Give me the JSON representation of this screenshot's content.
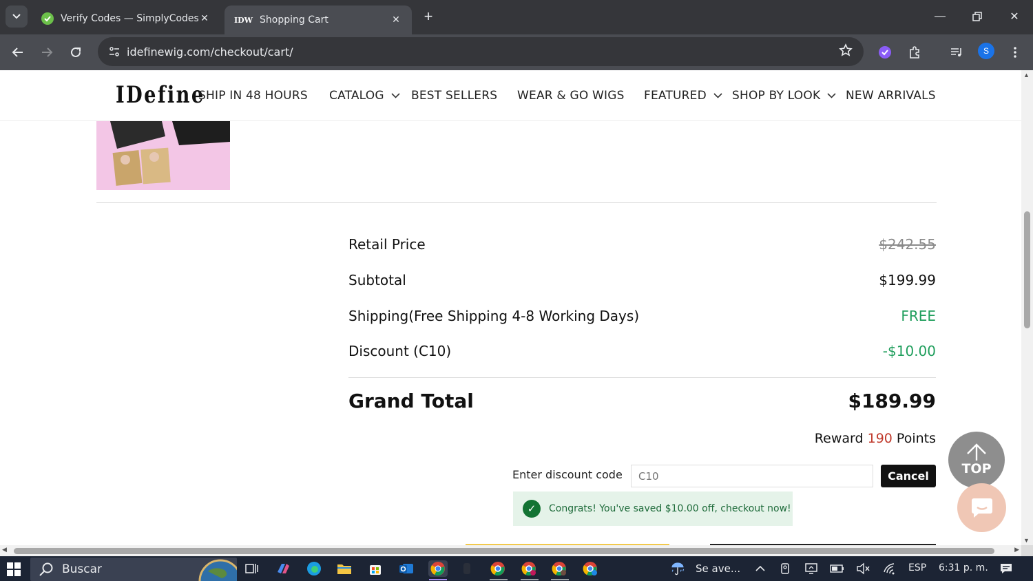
{
  "browser": {
    "tabs": [
      {
        "title": "Verify Codes — SimplyCodes",
        "favicon": "simplycodes-icon"
      },
      {
        "title": "Shopping Cart",
        "favicon_text": "IDW"
      }
    ],
    "url": "idefinewig.com/checkout/cart/",
    "profile_initial": "S"
  },
  "site": {
    "logo": "IDefine",
    "menu": [
      {
        "label": "SHIP IN 48 HOURS",
        "has_dropdown": false
      },
      {
        "label": "CATALOG",
        "has_dropdown": true
      },
      {
        "label": "BEST SELLERS",
        "has_dropdown": false
      },
      {
        "label": "WEAR & GO WIGS",
        "has_dropdown": false
      },
      {
        "label": "FEATURED",
        "has_dropdown": true
      },
      {
        "label": "SHOP BY LOOK",
        "has_dropdown": true
      },
      {
        "label": "NEW ARRIVALS",
        "has_dropdown": false
      }
    ]
  },
  "summary": {
    "retail_label": "Retail Price",
    "retail_value": "$242.55",
    "subtotal_label": "Subtotal",
    "subtotal_value": "$199.99",
    "shipping_label": "Shipping(Free Shipping 4-8 Working Days)",
    "shipping_value": "FREE",
    "discount_label": "Discount (C10)",
    "discount_value": "-$10.00",
    "grand_label": "Grand Total",
    "grand_value": "$189.99",
    "reward_prefix": "Reward",
    "reward_points": "190",
    "reward_suffix": "Points"
  },
  "discount": {
    "label": "Enter discount code",
    "placeholder": "C10",
    "cancel_label": "Cancel",
    "success_message": "Congrats! You've saved $10.00 off, checkout now!"
  },
  "floating": {
    "top_label": "TOP"
  },
  "taskbar": {
    "search_placeholder": "Buscar",
    "weather_text": "Se ave...",
    "language": "ESP",
    "time": "6:31 p. m."
  },
  "colors": {
    "accent_green": "#1f9e5c",
    "reward_red": "#c0392b",
    "chrome_dark": "#35363a"
  }
}
